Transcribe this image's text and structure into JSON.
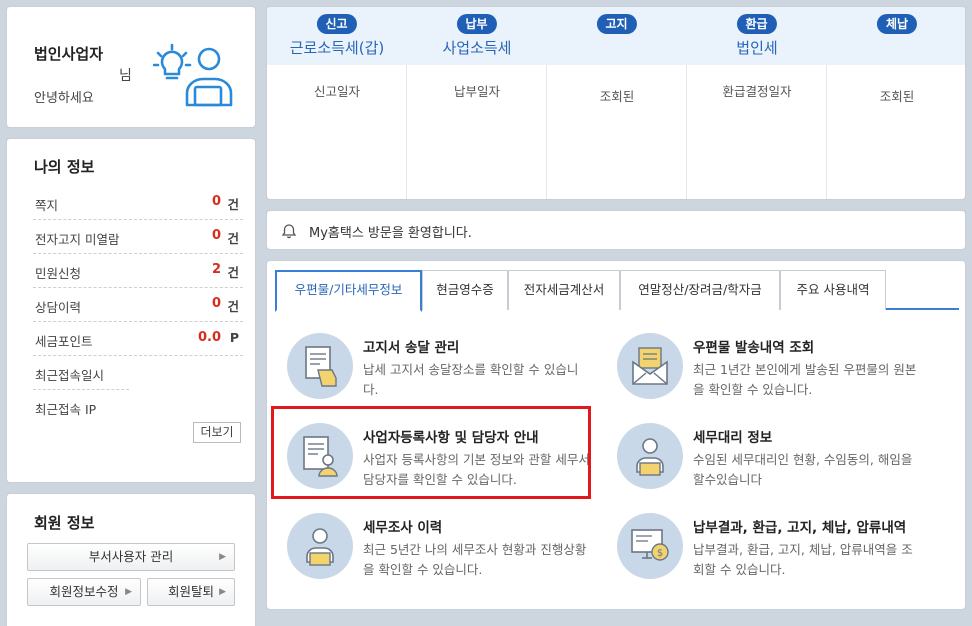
{
  "profile": {
    "user_type": "법인사업자",
    "honorific": "님",
    "greeting": "안녕하세요"
  },
  "my_info": {
    "title": "나의 정보",
    "rows": [
      {
        "label": "쪽지",
        "value": "0",
        "unit": "건"
      },
      {
        "label": "전자고지 미열람",
        "value": "0",
        "unit": "건"
      },
      {
        "label": "민원신청",
        "value": "2",
        "unit": "건"
      },
      {
        "label": "상담이력",
        "value": "0",
        "unit": "건"
      },
      {
        "label": "세금포인트",
        "value": "0.0",
        "unit": "P"
      },
      {
        "label": "최근접속일시",
        "value": "",
        "unit": ""
      },
      {
        "label": "최근접속 IP",
        "value": "",
        "unit": ""
      }
    ],
    "more_label": "더보기"
  },
  "member": {
    "title": "회원 정보",
    "sub_user_btn": "부서사용자 관리",
    "edit_btn": "회원정보수정",
    "withdraw_btn": "회원탈퇴"
  },
  "tax_cards": [
    {
      "badge": "신고",
      "name": "근로소득세(갑)",
      "sub": "신고일자"
    },
    {
      "badge": "납부",
      "name": "사업소득세",
      "sub": "납부일자"
    },
    {
      "badge": "고지",
      "name": "",
      "sub": "조회된"
    },
    {
      "badge": "환급",
      "name": "법인세",
      "sub": "환급결정일자"
    },
    {
      "badge": "체납",
      "name": "",
      "sub": "조회된"
    }
  ],
  "welcome": {
    "message": "My홈택스 방문을 환영합니다."
  },
  "tabs": [
    {
      "label": "우편물/기타세무정보",
      "active": true
    },
    {
      "label": "현금영수증",
      "active": false
    },
    {
      "label": "전자세금계산서",
      "active": false
    },
    {
      "label": "연말정산/장려금/학자금",
      "active": false
    },
    {
      "label": "주요 사용내역",
      "active": false
    }
  ],
  "services": [
    {
      "title": "고지서 송달 관리",
      "desc": "납세 고지서 송달장소를 확인할 수 있습니다.",
      "icon": "document-hand-icon"
    },
    {
      "title": "우편물 발송내역 조회",
      "desc": "최근 1년간 본인에게 발송된 우편물의 원본을 확인할 수 있습니다.",
      "icon": "envelope-icon"
    },
    {
      "title": "사업자등록사항 및 담당자 안내",
      "desc": "사업자 등록사항의 기본 정보와 관할 세무서 담당자를 확인할 수 있습니다.",
      "icon": "document-person-icon"
    },
    {
      "title": "세무대리 정보",
      "desc": "수임된 세무대리인 현황, 수임동의, 해임을 할수있습니다",
      "icon": "agent-person-icon"
    },
    {
      "title": "세무조사 이력",
      "desc": "최근 5년간 나의 세무조사 현황과 진행상황을 확인할 수 있습니다.",
      "icon": "investigator-icon"
    },
    {
      "title": "납부결과, 환급, 고지, 체납, 압류내역",
      "desc": "납부결과, 환급, 고지, 체납, 압류내역을 조회할 수 있습니다.",
      "icon": "monitor-coin-icon"
    }
  ],
  "colors": {
    "accent": "#2866b8",
    "badge": "#1f5fb6",
    "count_red": "#d72c1c",
    "highlight": "#e1181c",
    "icon_circle": "#c9d8e8"
  }
}
